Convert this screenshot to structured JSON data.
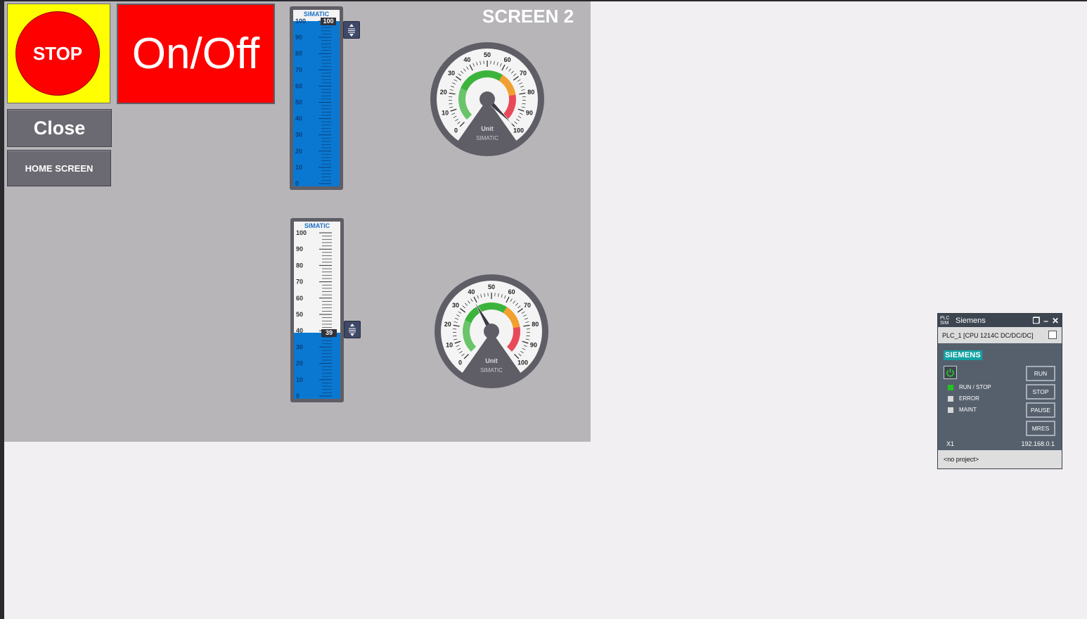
{
  "hmi": {
    "screen_title": "SCREEN 2",
    "stop_button": "STOP",
    "onoff_button": "On/Off",
    "close_button": "Close",
    "home_button": "HOME SCREEN"
  },
  "bars": [
    {
      "brand": "SIMATIC",
      "value": 100,
      "value_label": "100",
      "ticks": [
        "100",
        "90",
        "80",
        "70",
        "60",
        "50",
        "40",
        "30",
        "20",
        "10",
        "0"
      ]
    },
    {
      "brand": "SIMATIC",
      "value": 39,
      "value_label": "39",
      "ticks": [
        "100",
        "90",
        "80",
        "70",
        "60",
        "50",
        "40",
        "30",
        "20",
        "10",
        "0"
      ]
    }
  ],
  "gauges": [
    {
      "value": 100,
      "unit": "Unit",
      "brand": "SIMATIC",
      "labels": [
        "0",
        "10",
        "20",
        "30",
        "40",
        "50",
        "60",
        "70",
        "80",
        "90",
        "100"
      ]
    },
    {
      "value": 39,
      "unit": "Unit",
      "brand": "SIMATIC",
      "labels": [
        "0",
        "10",
        "20",
        "30",
        "40",
        "50",
        "60",
        "70",
        "80",
        "90",
        "100"
      ]
    }
  ],
  "colors": {
    "bar_fill": "#0a78d1",
    "green_zone": "#3cb43c",
    "orange_zone": "#f0a030",
    "red_zone": "#e84a5a"
  },
  "plcsim": {
    "logo": "PLC SIM",
    "title": "Siemens",
    "cpu": "PLC_1 [CPU 1214C DC/DC/DC]",
    "brand": "SIEMENS",
    "leds": [
      {
        "label": "RUN / STOP",
        "color": "#22c322"
      },
      {
        "label": "ERROR",
        "color": "#d8d8d8"
      },
      {
        "label": "MAINT",
        "color": "#d8d8d8"
      }
    ],
    "buttons": {
      "run": "RUN",
      "stop": "STOP",
      "pause": "PAUSE",
      "mres": "MRES"
    },
    "interface": "X1",
    "ip": "192.168.0.1",
    "project": "<no project>"
  }
}
